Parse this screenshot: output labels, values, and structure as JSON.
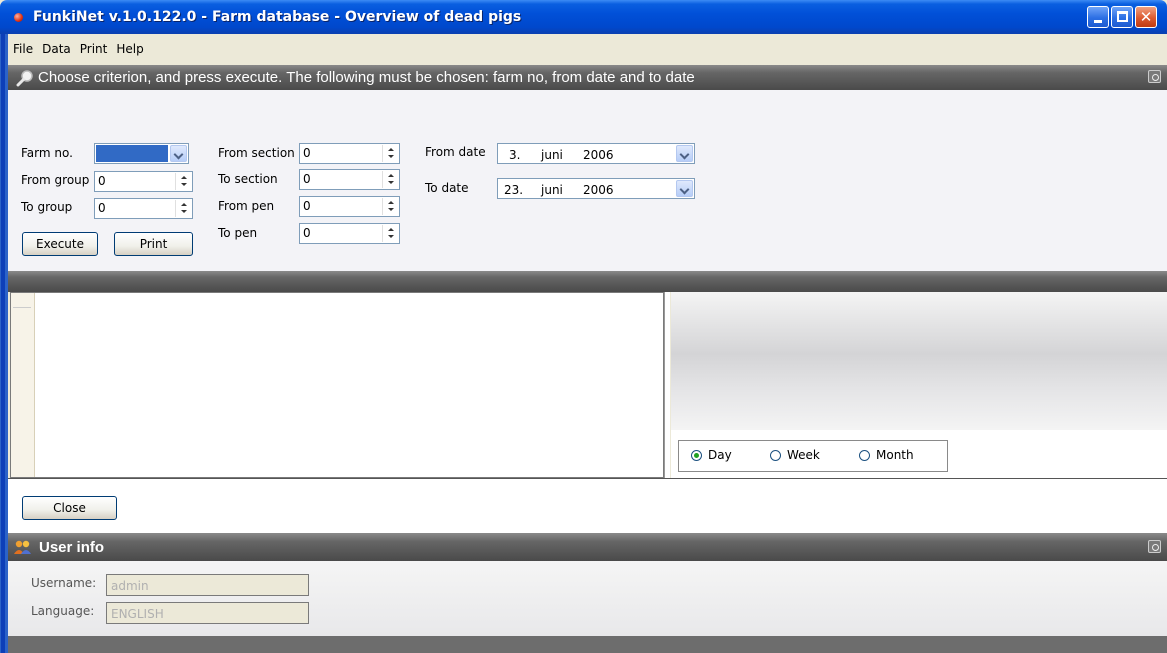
{
  "window": {
    "title": "FunkiNet v.1.0.122.0 - Farm database - Overview of dead pigs",
    "close_glyph": "✕"
  },
  "menu": [
    "File",
    "Data",
    "Print",
    "Help"
  ],
  "criteria": {
    "header": "Choose criterion, and press execute. The following must be chosen: farm no, from date and to date",
    "farm_no_label": "Farm no.",
    "from_group_label": "From group",
    "from_group_value": "0",
    "to_group_label": "To group",
    "to_group_value": "0",
    "from_section_label": "From section",
    "from_section_value": "0",
    "to_section_label": "To section",
    "to_section_value": "0",
    "from_pen_label": "From pen",
    "from_pen_value": "0",
    "to_pen_label": "To pen",
    "to_pen_value": "0",
    "from_date_label": "From date",
    "from_date": {
      "day": "3.",
      "month": "juni",
      "year": "2006"
    },
    "to_date_label": "To date",
    "to_date": {
      "day": "23.",
      "month": "juni",
      "year": "2006"
    },
    "execute_label": "Execute",
    "print_label": "Print"
  },
  "period": {
    "options": [
      "Day",
      "Week",
      "Month"
    ],
    "selected": "Day"
  },
  "close_label": "Close",
  "user_info": {
    "header": "User info",
    "username_label": "Username:",
    "username_value": "admin",
    "language_label": "Language:",
    "language_value": "ENGLISH"
  }
}
